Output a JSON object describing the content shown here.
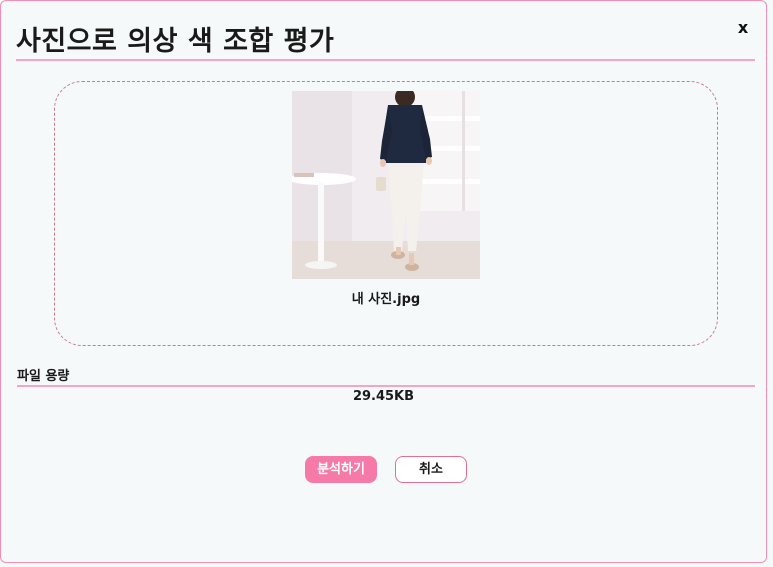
{
  "dialog": {
    "title": "사진으로 의상 색 조합 평가",
    "close_label": "x"
  },
  "upload": {
    "file_name": "내 사진.jpg"
  },
  "file_size": {
    "label": "파일 용량",
    "value": "29.45KB"
  },
  "actions": {
    "analyze_label": "분석하기",
    "cancel_label": "취소"
  },
  "colors": {
    "accent": "#f57aa7",
    "divider": "#f4a5c0",
    "dashed_border": "#c97a8e"
  }
}
